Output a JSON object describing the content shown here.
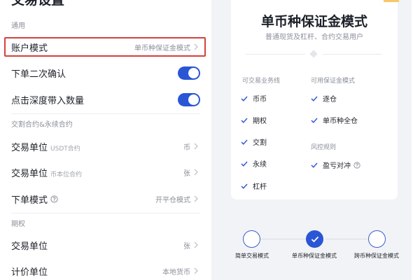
{
  "settings": {
    "page_title": "交易设置",
    "sections": {
      "general": "通用",
      "futures": "交割合约&永续合约",
      "options": "期权"
    },
    "account_mode": {
      "label": "账户模式",
      "value": "单币种保证金模式"
    },
    "order_confirm": {
      "label": "下单二次确认",
      "enabled": true
    },
    "depth_quantity": {
      "label": "点击深度带入数量",
      "enabled": true
    },
    "trade_unit_usdt": {
      "label": "交易单位",
      "sub": "USDT合约",
      "value": "币"
    },
    "trade_unit_coin": {
      "label": "交易单位",
      "sub": "币本位合约",
      "value": "张"
    },
    "order_mode": {
      "label": "下单模式",
      "value": "开平仓模式"
    },
    "options_trade_unit": {
      "label": "交易单位",
      "value": "张"
    },
    "pricing_unit": {
      "label": "计价单位",
      "value": "本地货币"
    }
  },
  "mode_card": {
    "title": "单币种保证金模式",
    "subtitle": "普通现货及杠杆、合约交易用户",
    "business_header": "可交易业务线",
    "business_items": [
      "币币",
      "期权",
      "交割",
      "永续",
      "杠杆"
    ],
    "margin_header": "可用保证金模式",
    "margin_items": [
      "逐仓",
      "单币种全仓"
    ],
    "risk_header": "风控规则",
    "risk_items": [
      "盈亏对冲"
    ]
  },
  "stepper": {
    "steps": [
      {
        "label": "简单交易模式",
        "active": false
      },
      {
        "label": "单币种保证金模式",
        "active": true
      },
      {
        "label": "跨币种保证金模式",
        "active": false
      }
    ]
  },
  "colors": {
    "accent": "#2a56d6",
    "highlight_border": "#d4423c",
    "check": "#2a56d6"
  }
}
